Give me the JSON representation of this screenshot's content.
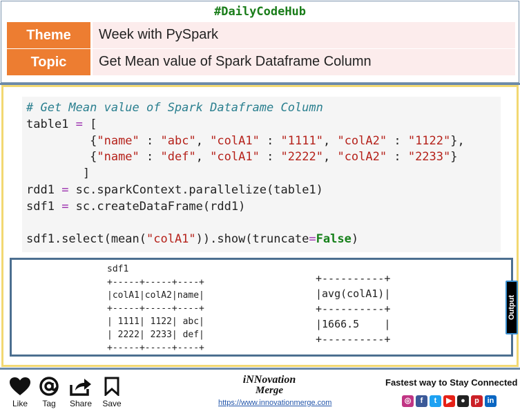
{
  "header": {
    "hashtag": "#DailyCodeHub",
    "rows": [
      {
        "label": "Theme",
        "value": "Week with PySpark"
      },
      {
        "label": "Topic",
        "value": "Get Mean value of Spark Dataframe Column"
      }
    ]
  },
  "code": {
    "lines": [
      [
        {
          "t": "# Get Mean value of Spark Dataframe Column",
          "c": "cm"
        }
      ],
      [
        {
          "t": "table1 "
        },
        {
          "t": "=",
          "c": "op"
        },
        {
          "t": " ["
        }
      ],
      [
        {
          "t": "         {"
        },
        {
          "t": "\"name\"",
          "c": "str"
        },
        {
          "t": " : "
        },
        {
          "t": "\"abc\"",
          "c": "str"
        },
        {
          "t": ", "
        },
        {
          "t": "\"colA1\"",
          "c": "str"
        },
        {
          "t": " : "
        },
        {
          "t": "\"1111\"",
          "c": "str"
        },
        {
          "t": ", "
        },
        {
          "t": "\"colA2\"",
          "c": "str"
        },
        {
          "t": " : "
        },
        {
          "t": "\"1122\"",
          "c": "str"
        },
        {
          "t": "},"
        }
      ],
      [
        {
          "t": "         {"
        },
        {
          "t": "\"name\"",
          "c": "str"
        },
        {
          "t": " : "
        },
        {
          "t": "\"def\"",
          "c": "str"
        },
        {
          "t": ", "
        },
        {
          "t": "\"colA1\"",
          "c": "str"
        },
        {
          "t": " : "
        },
        {
          "t": "\"2222\"",
          "c": "str"
        },
        {
          "t": ", "
        },
        {
          "t": "\"colA2\"",
          "c": "str"
        },
        {
          "t": " : "
        },
        {
          "t": "\"2233\"",
          "c": "str"
        },
        {
          "t": "}"
        }
      ],
      [
        {
          "t": "        ]"
        }
      ],
      [
        {
          "t": "rdd1 "
        },
        {
          "t": "=",
          "c": "op"
        },
        {
          "t": " sc.sparkContext.parallelize(table1)"
        }
      ],
      [
        {
          "t": "sdf1 "
        },
        {
          "t": "=",
          "c": "op"
        },
        {
          "t": " sc.createDataFrame(rdd1)"
        }
      ],
      [
        {
          "t": ""
        }
      ],
      [
        {
          "t": "sdf1.select(mean("
        },
        {
          "t": "\"colA1\"",
          "c": "str"
        },
        {
          "t": ")).show(truncate"
        },
        {
          "t": "=",
          "c": "op"
        },
        {
          "t": "False",
          "c": "kw"
        },
        {
          "t": ")"
        }
      ]
    ]
  },
  "output": {
    "left": "sdf1\n+-----+-----+----+\n|colA1|colA2|name|\n+-----+-----+----+\n| 1111| 1122| abc|\n| 2222| 2233| def|\n+-----+-----+----+",
    "right": "+----------+\n|avg(colA1)|\n+----------+\n|1666.5    |\n+----------+",
    "tab_label": "Output"
  },
  "footer": {
    "actions": [
      {
        "label": "Like",
        "icon": "heart-icon"
      },
      {
        "label": "Tag",
        "icon": "at-icon"
      },
      {
        "label": "Share",
        "icon": "share-icon"
      },
      {
        "label": "Save",
        "icon": "bookmark-icon"
      }
    ],
    "brand_line1": "iNNovation",
    "brand_line2": "Merge",
    "url": "https://www.innovationmerge.com",
    "tagline": "Fastest way to Stay Connected",
    "socials": [
      {
        "name": "instagram-icon",
        "glyph": "◎",
        "color": "#c13584"
      },
      {
        "name": "facebook-icon",
        "glyph": "f",
        "color": "#3b5998"
      },
      {
        "name": "twitter-icon",
        "glyph": "t",
        "color": "#1da1f2"
      },
      {
        "name": "youtube-icon",
        "glyph": "▶",
        "color": "#e62117"
      },
      {
        "name": "github-icon",
        "glyph": "●",
        "color": "#222222"
      },
      {
        "name": "pinterest-icon",
        "glyph": "p",
        "color": "#cb2027"
      },
      {
        "name": "linkedin-icon",
        "glyph": "in",
        "color": "#0a66c2"
      }
    ]
  }
}
